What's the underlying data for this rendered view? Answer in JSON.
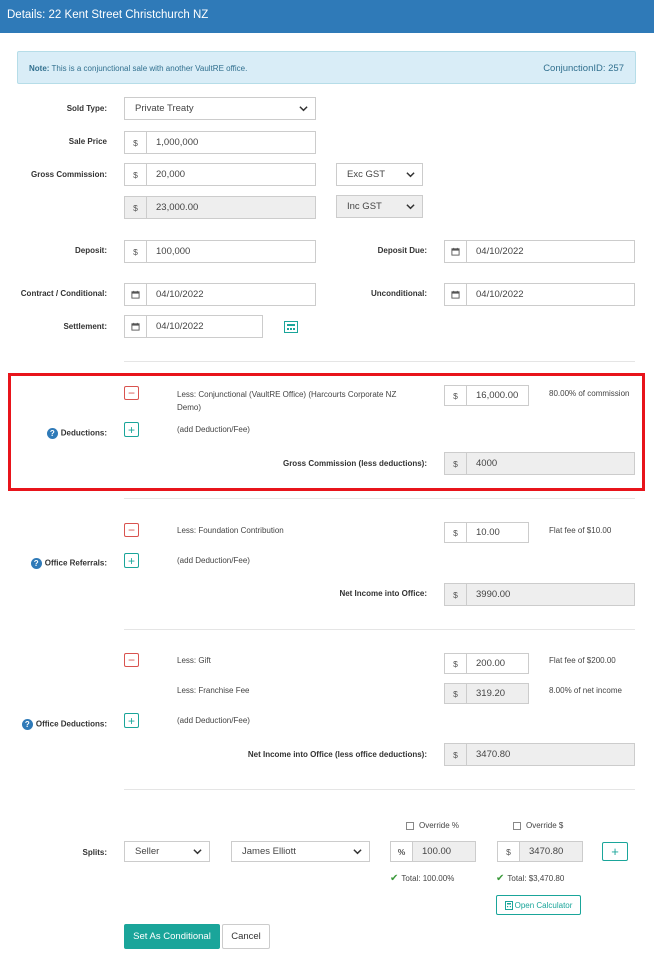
{
  "header": {
    "title": "Details: 22 Kent Street Christchurch NZ"
  },
  "note": {
    "label": "Note:",
    "text": "This is a conjunctional sale with another VaultRE office.",
    "conjunction": "ConjunctionID: 257"
  },
  "form": {
    "sold_type": {
      "label": "Sold Type:",
      "value": "Private Treaty"
    },
    "sale_price": {
      "label": "Sale Price",
      "prefix": "$",
      "value": "1,000,000"
    },
    "gross_commission": {
      "label": "Gross Commission:",
      "prefix": "$",
      "value": "20,000",
      "gst": "Exc GST",
      "inc_value": "23,000.00",
      "inc_gst": "Inc GST"
    },
    "deposit": {
      "label": "Deposit:",
      "prefix": "$",
      "value": "100,000"
    },
    "deposit_due": {
      "label": "Deposit Due:",
      "value": "04/10/2022"
    },
    "contract": {
      "label": "Contract / Conditional:",
      "value": "04/10/2022"
    },
    "unconditional": {
      "label": "Unconditional:",
      "value": "04/10/2022"
    },
    "settlement": {
      "label": "Settlement:",
      "value": "04/10/2022"
    }
  },
  "deductions": {
    "label": "Deductions:",
    "item1": "Less: Conjunctional (VaultRE Office) (Harcourts Corporate NZ Demo)",
    "item1_line1": "Less: Conjunctional (VaultRE Office) (Harcourts Corporate NZ",
    "item1_line2": "Demo)",
    "item1_value": "16,000.00",
    "item1_note": "80.00% of commission",
    "add": "(add Deduction/Fee)",
    "total_label": "Gross Commission (less deductions):",
    "total_value": "4000",
    "prefix": "$"
  },
  "referrals": {
    "label": "Office Referrals:",
    "item1": "Less: Foundation Contribution",
    "item1_value": "10.00",
    "item1_note": "Flat fee of $10.00",
    "add": "(add Deduction/Fee)",
    "total_label": "Net Income into Office:",
    "total_value": "3990.00"
  },
  "office_deductions": {
    "label": "Office Deductions:",
    "item1": "Less: Gift",
    "item1_value": "200.00",
    "item1_note": "Flat fee of $200.00",
    "item2": "Less: Franchise Fee",
    "item2_value": "319.20",
    "item2_note": "8.00% of net income",
    "add": "(add Deduction/Fee)",
    "total_label": "Net Income into Office (less office deductions):",
    "total_value": "3470.80"
  },
  "splits": {
    "label": "Splits:",
    "override_pct": "Override %",
    "override_amt": "Override $",
    "type": "Seller",
    "person": "James Elliott",
    "pct_prefix": "%",
    "pct_value": "100.00",
    "amt_prefix": "$",
    "amt_value": "3470.80",
    "total_pct": "Total: 100.00%",
    "total_amt": "Total: $3,470.80",
    "calculator": "Open Calculator"
  },
  "actions": {
    "primary": "Set As Conditional",
    "cancel": "Cancel"
  },
  "colors": {
    "header": "#2f7ab8",
    "accent": "#1aa59a",
    "danger": "#d9534f",
    "highlight": "#e8141b",
    "note_bg": "#d9edf7"
  }
}
